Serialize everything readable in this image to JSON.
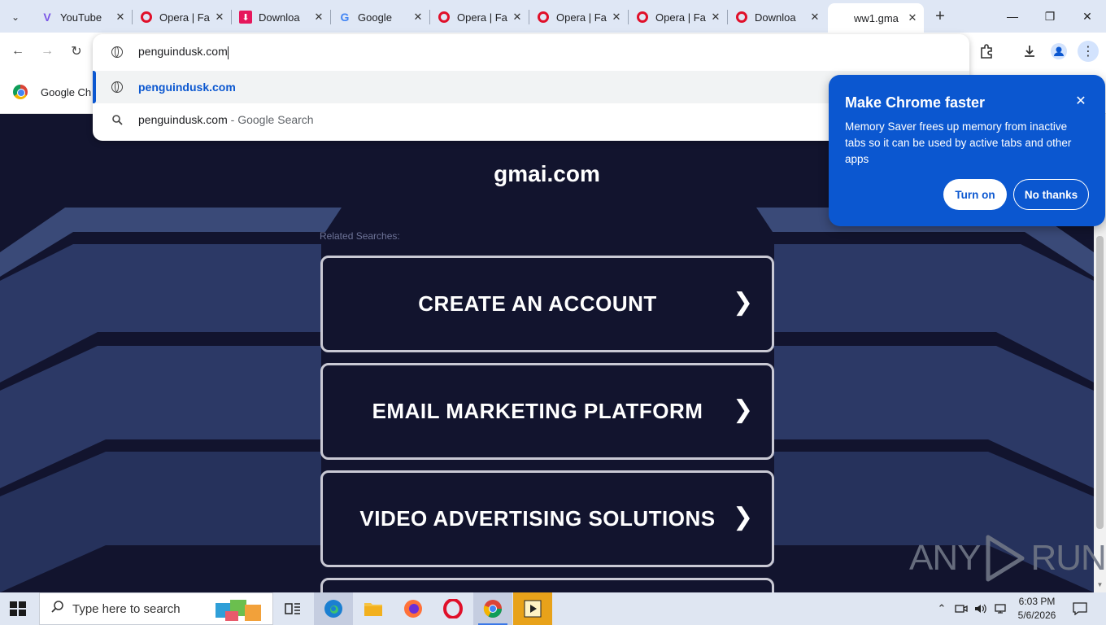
{
  "tabs": [
    {
      "title": "YouTube",
      "favicon": "youtube-icon"
    },
    {
      "title": "Opera | Fa",
      "favicon": "opera-icon"
    },
    {
      "title": "Downloa",
      "favicon": "download-icon"
    },
    {
      "title": "Google",
      "favicon": "google-icon"
    },
    {
      "title": "Opera | Fa",
      "favicon": "opera-icon"
    },
    {
      "title": "Opera | Fa",
      "favicon": "opera-icon"
    },
    {
      "title": "Opera | Fa",
      "favicon": "opera-icon"
    },
    {
      "title": "Downloa",
      "favicon": "opera-icon"
    },
    {
      "title": "ww1.gma",
      "favicon": "none",
      "active": true
    }
  ],
  "omnibox": {
    "input_value": "penguindusk.com",
    "suggestion_url": "penguindusk.com",
    "search_query": "penguindusk.com",
    "search_suffix": " - Google Search"
  },
  "bookmarks": {
    "item_label": "Google Ch"
  },
  "page": {
    "title": "gmai.com",
    "related_label": "Related Searches:",
    "links": [
      "CREATE AN ACCOUNT",
      "EMAIL MARKETING PLATFORM",
      "VIDEO ADVERTISING SOLUTIONS"
    ]
  },
  "popup": {
    "title": "Make Chrome faster",
    "body": "Memory Saver frees up memory from inactive tabs so it can be used by active tabs and other apps",
    "turn_on": "Turn on",
    "no_thanks": "No thanks"
  },
  "watermark": {
    "left": "ANY",
    "right": "RUN"
  },
  "taskbar": {
    "search_placeholder": "Type here to search",
    "time": "6:03 PM",
    "date": "5/6/2026"
  },
  "colors": {
    "popup_blue": "#0b57d0",
    "page_bg": "#12142e",
    "tabstrip": "#dfe7f5"
  }
}
